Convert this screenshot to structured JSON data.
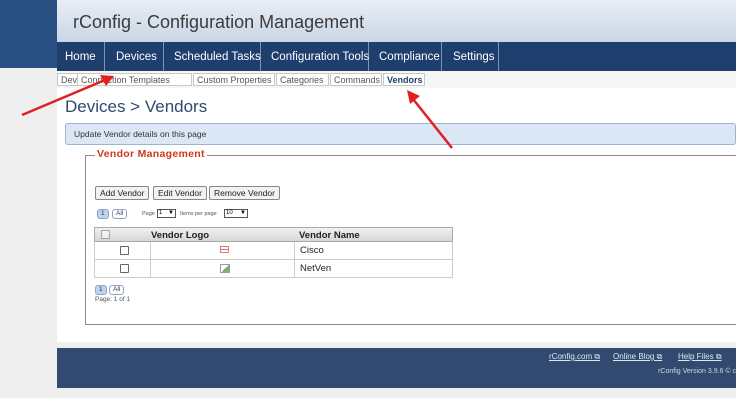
{
  "app": {
    "title": "rConfig - Configuration Management"
  },
  "nav": {
    "items": [
      {
        "label": "Home"
      },
      {
        "label": "Devices"
      },
      {
        "label": "Scheduled Tasks"
      },
      {
        "label": "Configuration Tools"
      },
      {
        "label": "Compliance"
      },
      {
        "label": "Settings"
      }
    ]
  },
  "subnav": {
    "items": [
      {
        "label": "Devices"
      },
      {
        "label": "Connection Templates"
      },
      {
        "label": "Custom Properties"
      },
      {
        "label": "Categories"
      },
      {
        "label": "Commands"
      },
      {
        "label": "Vendors"
      }
    ]
  },
  "page": {
    "title": "Devices > Vendors",
    "info": "Update Vendor details on this page"
  },
  "panel": {
    "legend": "Vendor Management",
    "buttons": {
      "add": "Add Vendor",
      "edit": "Edit Vendor",
      "remove": "Remove Vendor"
    },
    "pager": {
      "page_btn": "1",
      "all_btn": "All",
      "page_label": "Page",
      "page_value": "1",
      "items_label": "Items per page",
      "items_value": "10",
      "summary": "Page: 1 of 1"
    },
    "table": {
      "headers": {
        "logo": "Vendor Logo",
        "name": "Vendor Name"
      },
      "rows": [
        {
          "name": "Cisco"
        },
        {
          "name": "NetVen"
        }
      ]
    }
  },
  "footer": {
    "links": [
      {
        "label": "rConfig.com"
      },
      {
        "label": "Online Blog"
      },
      {
        "label": "Help Files"
      }
    ],
    "version": "rConfig Version 3.9.6  © c"
  },
  "colors": {
    "nav_bg": "#1e3e6e",
    "accent_red": "#e02020",
    "legend": "#cc3a1a"
  }
}
